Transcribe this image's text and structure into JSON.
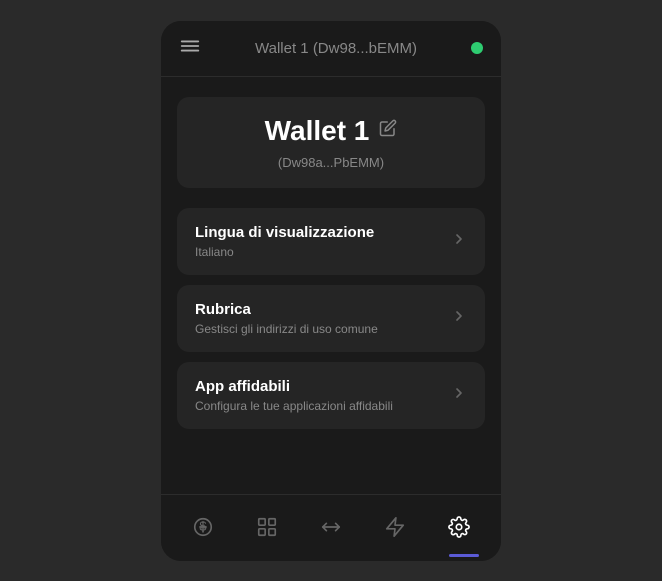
{
  "header": {
    "title": "Wallet 1",
    "address_short": "(Dw98...bEMM)",
    "status": "online"
  },
  "wallet": {
    "name": "Wallet 1",
    "address": "(Dw98a...PbEMM)"
  },
  "menu_items": [
    {
      "title": "Lingua di visualizzazione",
      "subtitle": "Italiano"
    },
    {
      "title": "Rubrica",
      "subtitle": "Gestisci gli indirizzi di uso comune"
    },
    {
      "title": "App affidabili",
      "subtitle": "Configura le tue applicazioni affidabili"
    }
  ],
  "nav": {
    "items": [
      {
        "name": "wallet-nav",
        "label": "Wallet"
      },
      {
        "name": "grid-nav",
        "label": "Grid"
      },
      {
        "name": "transfer-nav",
        "label": "Transfer"
      },
      {
        "name": "lightning-nav",
        "label": "Lightning"
      },
      {
        "name": "settings-nav",
        "label": "Settings"
      }
    ]
  },
  "colors": {
    "accent": "#5b5bd6",
    "green": "#2ecc71",
    "active_nav": "#fff",
    "inactive_nav": "#666"
  }
}
